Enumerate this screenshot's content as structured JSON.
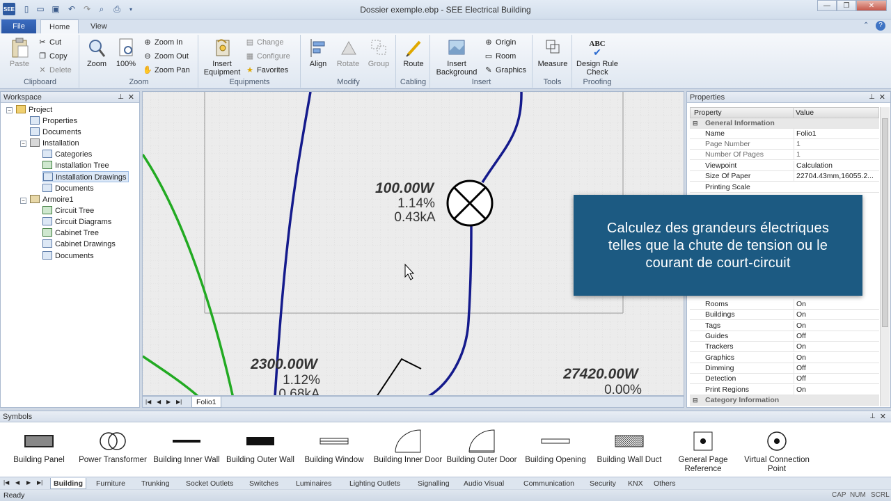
{
  "window": {
    "title": "Dossier exemple.ebp - SEE Electrical Building"
  },
  "tabs": {
    "file": "File",
    "home": "Home",
    "view": "View"
  },
  "ribbon": {
    "clipboard": {
      "label": "Clipboard",
      "paste": "Paste",
      "cut": "Cut",
      "copy": "Copy",
      "delete": "Delete"
    },
    "zoom": {
      "label": "Zoom",
      "zoom": "Zoom",
      "percent": "100%",
      "zoom_in": "Zoom In",
      "zoom_out": "Zoom Out",
      "zoom_pan": "Zoom Pan"
    },
    "equipments": {
      "label": "Equipments",
      "insert_equipment": "Insert Equipment",
      "change": "Change",
      "configure": "Configure",
      "favorites": "Favorites"
    },
    "modify": {
      "label": "Modify",
      "align": "Align",
      "rotate": "Rotate",
      "group": "Group"
    },
    "cabling": {
      "label": "Cabling",
      "route": "Route"
    },
    "insert": {
      "label": "Insert",
      "insert_background": "Insert Background",
      "origin": "Origin",
      "room": "Room",
      "graphics": "Graphics"
    },
    "tools": {
      "label": "Tools",
      "measure": "Measure"
    },
    "proofing": {
      "label": "Proofing",
      "design_rule_check": "Design Rule Check",
      "abc": "ABC"
    }
  },
  "workspace": {
    "title": "Workspace",
    "items": [
      {
        "label": "Project"
      },
      {
        "label": "Properties"
      },
      {
        "label": "Documents"
      },
      {
        "label": "Installation"
      },
      {
        "label": "Categories"
      },
      {
        "label": "Installation Tree"
      },
      {
        "label": "Installation Drawings"
      },
      {
        "label": "Documents"
      },
      {
        "label": "Armoire1"
      },
      {
        "label": "Circuit Tree"
      },
      {
        "label": "Circuit Diagrams"
      },
      {
        "label": "Cabinet Tree"
      },
      {
        "label": "Cabinet Drawings"
      },
      {
        "label": "Documents"
      }
    ]
  },
  "drawing": {
    "lamp": {
      "power": "100.00W",
      "drop": "1.14%",
      "current": "0.43kA"
    },
    "branch2": {
      "power": "2300.00W",
      "drop": "1.12%",
      "current": "0.68kA"
    },
    "branch3": {
      "power": "27420.00W",
      "drop": "0.00%"
    },
    "folio_tab": "Folio1"
  },
  "properties": {
    "title": "Properties",
    "col_property": "Property",
    "col_value": "Value",
    "general_category": "General Information",
    "rows_top": [
      {
        "name": "Name",
        "value": "Folio1"
      },
      {
        "name": "Page Number",
        "value": "1"
      },
      {
        "name": "Number Of Pages",
        "value": "1"
      },
      {
        "name": "Viewpoint",
        "value": "Calculation"
      },
      {
        "name": "Size Of Paper",
        "value": "22704.43mm,16055.2..."
      },
      {
        "name": "Printing Scale",
        "value": ""
      }
    ],
    "rows_bottom": [
      {
        "name": "Rooms",
        "value": "On"
      },
      {
        "name": "Buildings",
        "value": "On"
      },
      {
        "name": "Tags",
        "value": "On"
      },
      {
        "name": "Guides",
        "value": "Off"
      },
      {
        "name": "Trackers",
        "value": "On"
      },
      {
        "name": "Graphics",
        "value": "On"
      },
      {
        "name": "Dimming",
        "value": "Off"
      },
      {
        "name": "Detection",
        "value": "Off"
      },
      {
        "name": "Print Regions",
        "value": "On"
      }
    ],
    "category_category": "Category Information"
  },
  "overlay": {
    "line1": "Calculez des grandeurs électriques",
    "line2": "telles que la chute de tension ou le",
    "line3": "courant de court-circuit"
  },
  "symbols": {
    "title": "Symbols",
    "items": [
      {
        "label": "Building Panel"
      },
      {
        "label": "Power Transformer"
      },
      {
        "label": "Building Inner Wall"
      },
      {
        "label": "Building Outer Wall"
      },
      {
        "label": "Building Window"
      },
      {
        "label": "Building Inner Door"
      },
      {
        "label": "Building Outer Door"
      },
      {
        "label": "Building Opening"
      },
      {
        "label": "Building Wall Duct"
      },
      {
        "label": "General Page Reference"
      },
      {
        "label": "Virtual Connection Point"
      }
    ],
    "tabs": [
      "Building",
      "Furniture",
      "Trunking",
      "Socket Outlets",
      "Switches",
      "Luminaires",
      "Lighting Outlets",
      "Signalling",
      "Audio Visual",
      "Communication",
      "Security",
      "KNX",
      "Others"
    ]
  },
  "status": {
    "text": "Ready",
    "cap": "CAP",
    "num": "NUM",
    "scrl": "SCRL"
  }
}
